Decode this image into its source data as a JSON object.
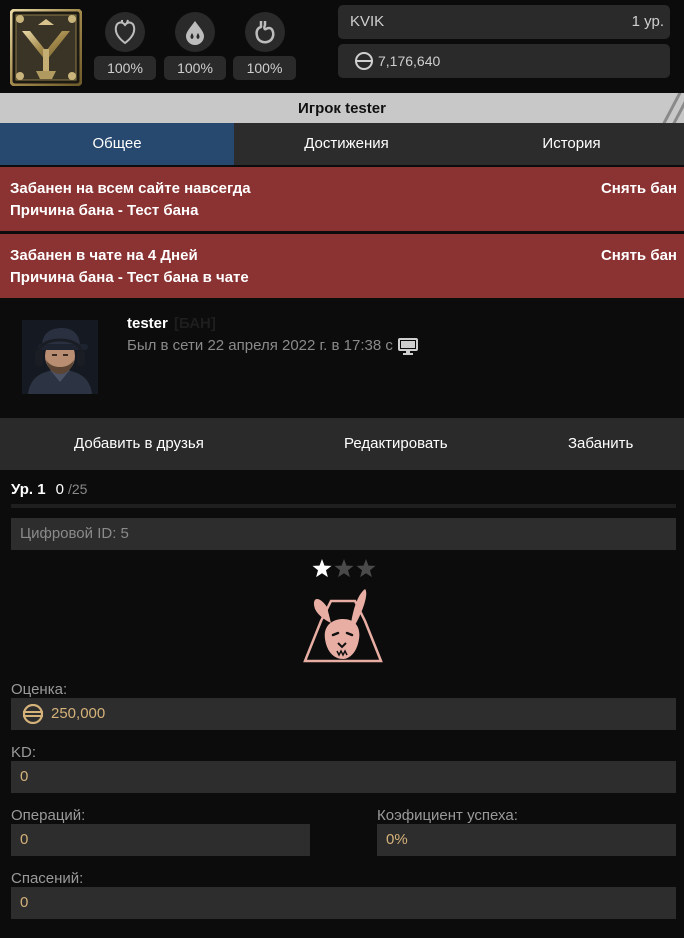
{
  "header": {
    "emblem_icon": "faction-emblem-icon",
    "stats": [
      {
        "icon": "heart-icon",
        "value": "100%"
      },
      {
        "icon": "water-drops-icon",
        "value": "100%"
      },
      {
        "icon": "stomach-icon",
        "value": "100%"
      }
    ],
    "clan": "KVIK",
    "level": "1 ур.",
    "currency_icon": "coin-icon",
    "balance": "7,176,640"
  },
  "title": "Игрок tester",
  "tabs": [
    {
      "label": "Общее",
      "active": true
    },
    {
      "label": "Достижения",
      "active": false
    },
    {
      "label": "История",
      "active": false
    }
  ],
  "bans": [
    {
      "title": "Забанен на всем сайте навсегда",
      "reason": "Причина бана - Тест бана",
      "action": "Снять бан"
    },
    {
      "title": "Забанен в чате на 4 Дней",
      "reason": "Причина бана - Тест бана в чате",
      "action": "Снять бан"
    }
  ],
  "profile": {
    "name": "tester",
    "banned_tag": "[БАН]",
    "last_seen": "Был в сети 22 апреля 2022 г. в 17:38 с",
    "device_icon": "desktop-icon"
  },
  "actions": {
    "add_friend": "Добавить в друзья",
    "edit": "Редактировать",
    "ban": "Забанить"
  },
  "level": {
    "label": "Ур. 1",
    "current": "0",
    "max": "/25",
    "progress": 0
  },
  "numeric_id": "Цифровой ID: 5",
  "rank": {
    "stars_filled": 1,
    "stars_total": 3,
    "icon": "rabbit-rank-icon"
  },
  "fields": {
    "rating_label": "Оценка:",
    "rating_value": "250,000",
    "kd_label": "KD:",
    "kd_value": "0",
    "operations_label": "Операций:",
    "operations_value": "0",
    "success_label": "Коэфициент успеха:",
    "success_value": "0%",
    "rescues_label": "Спасений:",
    "rescues_value": "0"
  },
  "colors": {
    "active_tab": "#27496f",
    "ban_bg": "#8b3232",
    "value_gold": "#d5b27a",
    "rank_pink": "#e8aea3"
  }
}
